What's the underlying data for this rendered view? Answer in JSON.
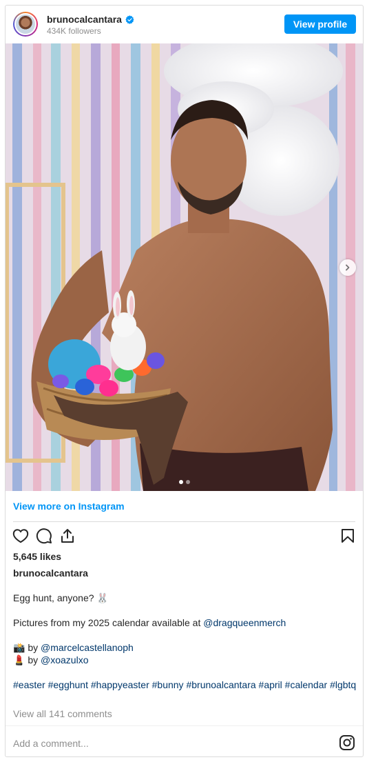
{
  "header": {
    "username": "brunocalcantara",
    "followers": "434K followers",
    "view_profile_label": "View profile"
  },
  "photo": {
    "slides_total": 2,
    "slide_active": 1
  },
  "view_more_label": "View more on Instagram",
  "likes": "5,645 likes",
  "caption": {
    "username": "brunocalcantara",
    "line1": "Egg hunt, anyone? 🐰",
    "line2_text": "Pictures from my 2025 calendar available at ",
    "line2_link": "@dragqueenmerch",
    "credit1_emoji": "📸",
    "credit1_text": " by ",
    "credit1_link": "@marcelcastellanoph",
    "credit2_emoji": "💄",
    "credit2_text": " by ",
    "credit2_link": "@xoazulxo",
    "hashtags": [
      "#easter",
      "#egghunt",
      "#happyeaster",
      "#bunny",
      "#brunoalcantara",
      "#april",
      "#calendar",
      "#lgbtq"
    ]
  },
  "view_comments": "View all 141 comments",
  "add_comment_placeholder": "Add a comment...",
  "icons": {
    "verified": "verified-badge-icon",
    "like": "heart-icon",
    "comment": "comment-icon",
    "share": "share-icon",
    "save": "bookmark-icon",
    "next": "chevron-right-icon",
    "instagram": "instagram-logo-icon"
  },
  "colors": {
    "accent": "#0095f6",
    "link": "#00376b",
    "muted": "#8e8e8e",
    "text": "#262626",
    "border": "#dbdbdb"
  }
}
